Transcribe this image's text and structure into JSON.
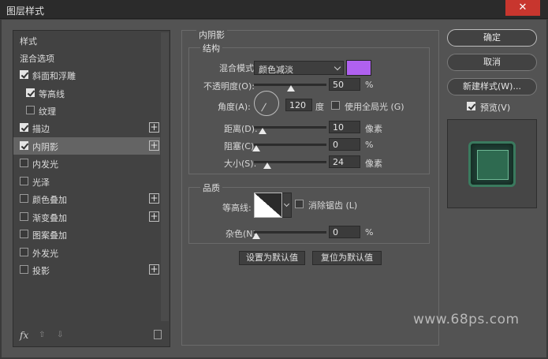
{
  "window": {
    "title": "图层样式",
    "close_glyph": "✕"
  },
  "left_panel": {
    "items": [
      {
        "label": "样式",
        "checkbox": "none"
      },
      {
        "label": "混合选项",
        "checkbox": "none"
      },
      {
        "label": "斜面和浮雕",
        "checkbox": "checked"
      },
      {
        "label": "等高线",
        "checkbox": "checked",
        "indent": true
      },
      {
        "label": "纹理",
        "checkbox": "unchecked",
        "indent": true
      },
      {
        "label": "描边",
        "checkbox": "checked",
        "plus": true
      },
      {
        "label": "内阴影",
        "checkbox": "checked",
        "plus": true,
        "selected": true
      },
      {
        "label": "内发光",
        "checkbox": "unchecked"
      },
      {
        "label": "光泽",
        "checkbox": "unchecked"
      },
      {
        "label": "颜色叠加",
        "checkbox": "unchecked",
        "plus": true
      },
      {
        "label": "渐变叠加",
        "checkbox": "unchecked",
        "plus": true
      },
      {
        "label": "图案叠加",
        "checkbox": "unchecked"
      },
      {
        "label": "外发光",
        "checkbox": "unchecked"
      },
      {
        "label": "投影",
        "checkbox": "unchecked",
        "plus": true
      }
    ],
    "plus_glyph": "+",
    "footer": {
      "fx_label": "fx",
      "up_arrow": "⇧",
      "down_arrow": "⇩",
      "trash_icon": "trash-icon"
    }
  },
  "inner_shadow": {
    "section_title": "内阴影",
    "structure": {
      "group_title": "结构",
      "blend_mode_label": "混合模式:",
      "blend_mode_value": "颜色减淡",
      "shadow_color": "#b061f0",
      "opacity_label": "不透明度(O):",
      "opacity_value": "50",
      "opacity_unit": "%",
      "angle_label": "角度(A):",
      "angle_value": "120",
      "angle_unit": "度",
      "global_light_label": "使用全局光 (G)",
      "global_light_checked": false,
      "distance_label": "距离(D):",
      "distance_value": "10",
      "distance_unit": "像素",
      "choke_label": "阻塞(C):",
      "choke_value": "0",
      "choke_unit": "%",
      "size_label": "大小(S):",
      "size_value": "24",
      "size_unit": "像素"
    },
    "quality": {
      "group_title": "品质",
      "contour_label": "等高线:",
      "antialias_label": "消除锯齿 (L)",
      "antialias_checked": false,
      "noise_label": "杂色(N):",
      "noise_value": "0",
      "noise_unit": "%"
    },
    "buttons": {
      "set_default": "设置为默认值",
      "reset_default": "复位为默认值"
    }
  },
  "right_panel": {
    "ok_label": "确定",
    "cancel_label": "取消",
    "new_style_label": "新建样式(W)...",
    "preview_label": "预览(V)",
    "preview_checked": true
  },
  "watermark": "www.68ps.com"
}
